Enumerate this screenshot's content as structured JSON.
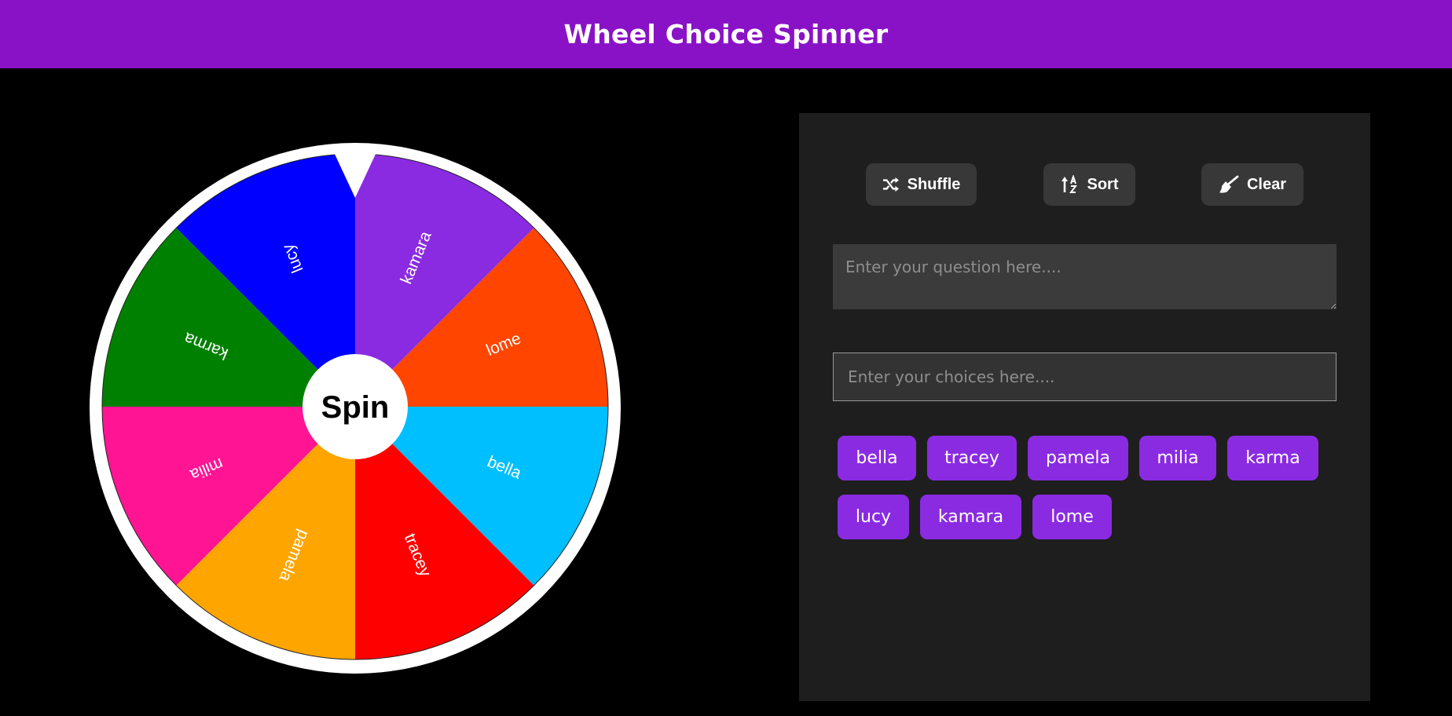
{
  "header": {
    "title": "Wheel Choice Spinner",
    "background": "#8a12c6"
  },
  "wheel": {
    "spin_label": "Spin",
    "segments": [
      {
        "label": "kamara",
        "color": "#8a2be2"
      },
      {
        "label": "lome",
        "color": "#ff4500"
      },
      {
        "label": "bella",
        "color": "#00bfff"
      },
      {
        "label": "tracey",
        "color": "#ff0000"
      },
      {
        "label": "pamela",
        "color": "#ffa500"
      },
      {
        "label": "milia",
        "color": "#ff1493"
      },
      {
        "label": "karma",
        "color": "#008000"
      },
      {
        "label": "lucy",
        "color": "#0000ff"
      }
    ]
  },
  "toolbar": {
    "shuffle_label": "Shuffle",
    "shuffle_icon": "shuffle-icon",
    "sort_label": "Sort",
    "sort_icon": "sort-icon",
    "clear_label": "Clear",
    "clear_icon": "broom-icon"
  },
  "question": {
    "placeholder": "Enter your question here....",
    "value": ""
  },
  "choices_input": {
    "placeholder": "Enter your choices here....",
    "value": ""
  },
  "choices": [
    "bella",
    "tracey",
    "pamela",
    "milia",
    "karma",
    "lucy",
    "kamara",
    "lome"
  ],
  "colors": {
    "accent": "#8a2be2",
    "panel": "#1e1e1e",
    "page": "#000000"
  }
}
